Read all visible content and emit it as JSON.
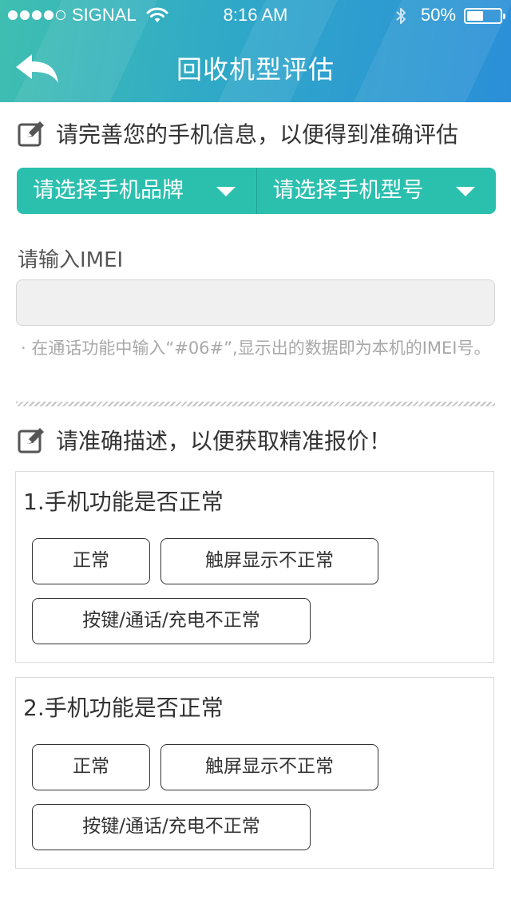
{
  "status_bar": {
    "carrier": "SIGNAL",
    "time": "8:16 AM",
    "battery": "50%",
    "battery_level": 0.5
  },
  "nav": {
    "title": "回收机型评估",
    "back_icon": "back-arrow-icon"
  },
  "info_section": {
    "heading": "请完善您的手机信息，以便得到准确评估",
    "icon": "edit-icon",
    "brand_select": "请选择手机品牌",
    "model_select": "请选择手机型号",
    "imei_label": "请输入IMEI",
    "imei_value": "",
    "imei_hint": "· 在通话功能中输入“#06#”,显示出的数据即为本机的IMEI号。"
  },
  "describe_section": {
    "heading": "请准确描述，以便获取精准报价！",
    "icon": "edit-icon"
  },
  "questions": [
    {
      "title": "1.手机功能是否正常",
      "options": [
        "正常",
        "触屏显示不正常",
        "按键/通话/充电不正常"
      ]
    },
    {
      "title": "2.手机功能是否正常",
      "options": [
        "正常",
        "触屏显示不正常",
        "按键/通话/充电不正常"
      ]
    }
  ],
  "colors": {
    "accent": "#2bbfae",
    "header_start": "#3fbfb0",
    "header_end": "#2b8fd8"
  }
}
